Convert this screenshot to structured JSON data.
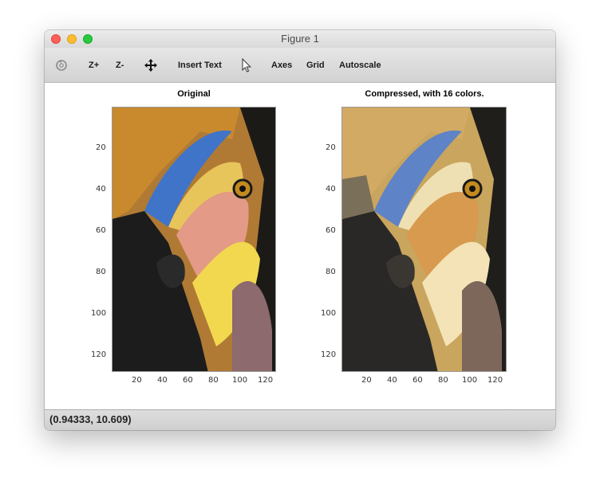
{
  "window": {
    "title": "Figure 1"
  },
  "traffic_lights": {
    "close_color": "#fd5f57",
    "minimize_color": "#febc2e",
    "zoom_color": "#28c840"
  },
  "toolbar": {
    "rotate_icon": "rotate-3d-icon",
    "zoom_in_label": "Z+",
    "zoom_out_label": "Z-",
    "pan_icon": "pan-arrows-icon",
    "insert_text_label": "Insert Text",
    "select_icon": "pointer-arrow-icon",
    "axes_label": "Axes",
    "grid_label": "Grid",
    "autoscale_label": "Autoscale"
  },
  "axes": [
    {
      "title": "Original",
      "xticks": [
        "20",
        "40",
        "60",
        "80",
        "100",
        "120"
      ],
      "yticks": [
        "20",
        "40",
        "60",
        "80",
        "100",
        "120"
      ],
      "palette": "original"
    },
    {
      "title": "Compressed, with 16 colors.",
      "xticks": [
        "20",
        "40",
        "60",
        "80",
        "100",
        "120"
      ],
      "yticks": [
        "20",
        "40",
        "60",
        "80",
        "100",
        "120"
      ],
      "palette": "compressed"
    }
  ],
  "status": {
    "coordinates": "(0.94333, 10.609)"
  },
  "colors": {
    "bird_orange": "#c98a2e",
    "bird_blue": "#4a78c4",
    "bird_yellow": "#efe2a0",
    "bird_dark": "#1c1c1c",
    "bird_pink": "#e39a86",
    "bird_mauve": "#8c6a6e"
  }
}
